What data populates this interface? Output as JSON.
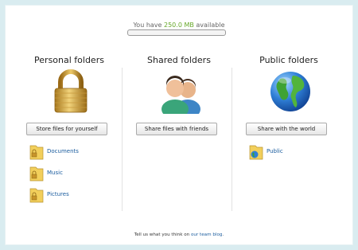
{
  "quota": {
    "prefix": "You have ",
    "amount": "250.0 MB",
    "suffix": " available",
    "used_fraction": 0.0
  },
  "columns": [
    {
      "title": "Personal folders",
      "icon": "padlock-icon",
      "button_label": "Store files for yourself",
      "folders": [
        "Documents",
        "Music",
        "Pictures"
      ]
    },
    {
      "title": "Shared folders",
      "icon": "users-icon",
      "button_label": "Share files with friends",
      "folders": []
    },
    {
      "title": "Public folders",
      "icon": "globe-icon",
      "button_label": "Share with the world",
      "folders": [
        "Public"
      ]
    }
  ],
  "footer": {
    "prefix": "Tell us what you think on ",
    "link": "our team blog",
    "suffix": "."
  },
  "colors": {
    "background": "#d9ecf0",
    "quota_amount": "#66a829",
    "link": "#1a5c9e",
    "folder_yellow": "#f2cf5b"
  }
}
